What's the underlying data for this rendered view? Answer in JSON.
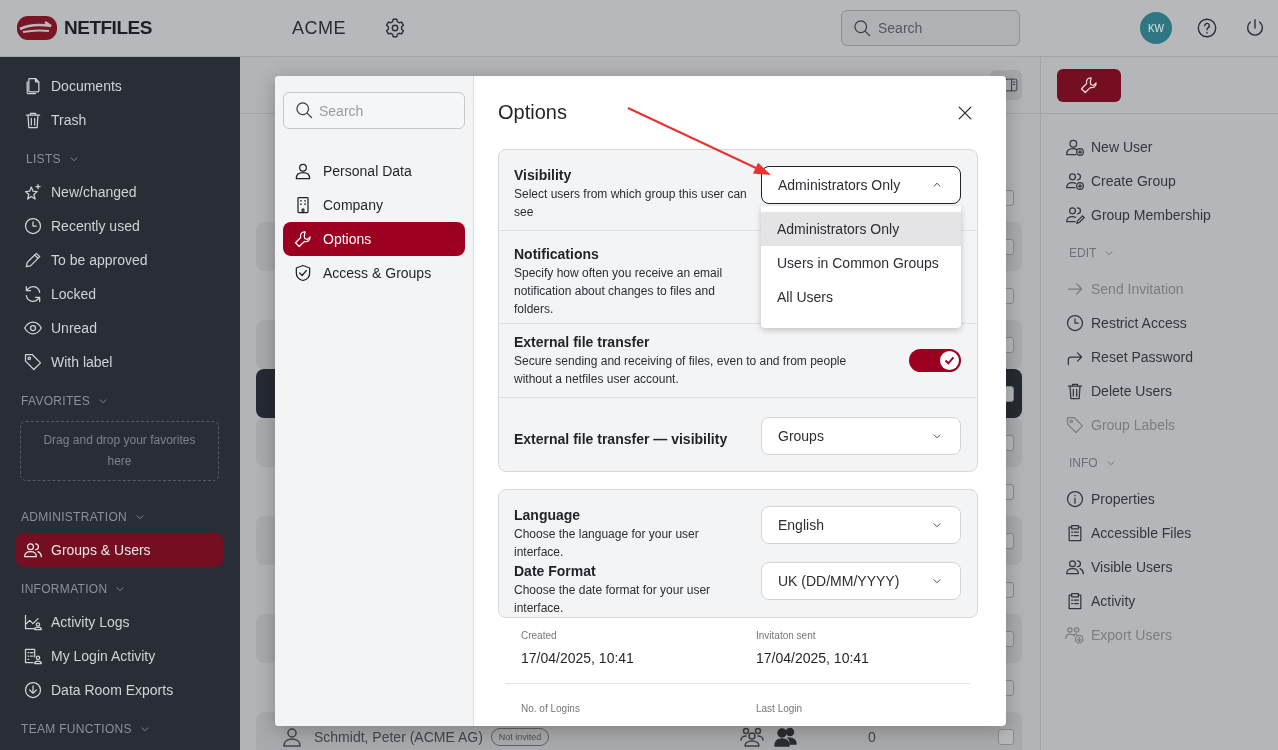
{
  "topbar": {
    "logo": "NETFILES",
    "workspace": "ACME",
    "search": {
      "placeholder": "Search"
    },
    "avatar": "KW"
  },
  "sidebar": [
    {
      "kind": "list",
      "items": [
        {
          "label": "Documents",
          "selected": false
        },
        {
          "label": "Trash",
          "selected": false
        }
      ]
    },
    {
      "kind": "list",
      "title": "LISTS",
      "items": [
        {
          "label": "New/changed",
          "selected": false
        },
        {
          "label": "Recently used",
          "selected": false
        },
        {
          "label": "To be approved",
          "selected": false
        },
        {
          "label": "Locked",
          "selected": false
        },
        {
          "label": "Unread",
          "selected": false
        },
        {
          "label": "With label",
          "selected": false
        }
      ]
    },
    {
      "kind": "dropzone",
      "title": "FAVORITES",
      "hint": "Drag and drop your favorites here"
    },
    {
      "kind": "list",
      "title": "ADMINISTRATION",
      "items": [
        {
          "label": "Groups & Users",
          "selected": true
        }
      ]
    },
    {
      "kind": "list",
      "title": "INFORMATION",
      "items": [
        {
          "label": "Activity Logs",
          "selected": false
        },
        {
          "label": "My Login Activity",
          "selected": false
        },
        {
          "label": "Data Room Exports",
          "selected": false
        }
      ]
    },
    {
      "kind": "list",
      "title": "TEAM FUNCTIONS"
    }
  ],
  "user_rows": [
    {
      "selected": false,
      "checked": false
    },
    {
      "selected": false,
      "checked": false
    },
    {
      "selected": false,
      "checked": false
    },
    {
      "selected": false,
      "checked": false
    },
    {
      "selected": true,
      "checked": false
    },
    {
      "selected": false,
      "checked": false
    },
    {
      "selected": false,
      "checked": false
    },
    {
      "selected": false,
      "checked": false
    },
    {
      "selected": false,
      "checked": false
    },
    {
      "selected": false,
      "checked": false
    },
    {
      "selected": false,
      "checked": false
    },
    {
      "name": "Schmidt, Peter (ACME AG)",
      "status": "Not invited",
      "logins": "0",
      "selected": false,
      "checked": false
    }
  ],
  "actions": [
    {
      "items": [
        {
          "label": "New User",
          "disabled": false
        },
        {
          "label": "Create Group",
          "disabled": false
        },
        {
          "label": "Group Membership",
          "disabled": false
        }
      ]
    },
    {
      "title": "EDIT",
      "items": [
        {
          "label": "Send Invitation",
          "disabled": true
        },
        {
          "label": "Restrict Access",
          "disabled": false
        },
        {
          "label": "Reset Password",
          "disabled": false
        },
        {
          "label": "Delete Users",
          "disabled": false
        },
        {
          "label": "Group Labels",
          "disabled": true
        }
      ]
    },
    {
      "title": "INFO",
      "items": [
        {
          "label": "Properties",
          "disabled": false
        },
        {
          "label": "Accessible Files",
          "disabled": false
        },
        {
          "label": "Visible Users",
          "disabled": false
        },
        {
          "label": "Activity",
          "disabled": false
        },
        {
          "label": "Export Users",
          "disabled": true
        }
      ]
    }
  ],
  "dialog": {
    "search": {
      "placeholder": "Search"
    },
    "nav": [
      {
        "label": "Personal Data",
        "selected": false
      },
      {
        "label": "Company",
        "selected": false
      },
      {
        "label": "Options",
        "selected": true
      },
      {
        "label": "Access & Groups",
        "selected": false
      }
    ],
    "title": "Options",
    "settings": [
      {
        "title": "Visibility",
        "description": "Select users from which group this user can see",
        "kind": "select",
        "value": "Administrators Only",
        "expanded": true,
        "options": [
          {
            "label": "Administrators Only",
            "selected": true
          },
          {
            "label": "Users in Common Groups",
            "selected": false
          },
          {
            "label": "All Users",
            "selected": false
          }
        ]
      },
      {
        "title": "Notifications",
        "description": "Specify how often you receive an email notification about changes to files and folders.",
        "kind": "info"
      },
      {
        "title": "External file transfer",
        "description": "Secure sending and receiving of files, even to and from people without a netfiles user account.",
        "kind": "toggle",
        "on": true
      },
      {
        "title": "External file transfer — visibility",
        "kind": "select",
        "value": "Groups",
        "expanded": false
      }
    ],
    "preferences": [
      {
        "title": "Language",
        "description": "Choose the language for your user interface.",
        "kind": "select",
        "value": "English",
        "expanded": false
      },
      {
        "title": "Date Format",
        "description": "Choose the date format for your user interface.",
        "kind": "select",
        "value": "UK (DD/MM/YYYY)",
        "expanded": false
      }
    ],
    "details": [
      {
        "label": "Created",
        "value": "17/04/2025, 10:41"
      },
      {
        "label": "Invitaton sent",
        "value": "17/04/2025, 10:41"
      },
      {
        "label": "No. of Logins"
      },
      {
        "label": "Last Login"
      }
    ]
  }
}
